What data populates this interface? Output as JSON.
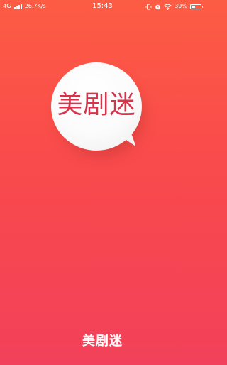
{
  "status_bar": {
    "network_type": "4G",
    "net_speed": "26.7K/s",
    "time": "15:43",
    "battery_percent": "39%",
    "battery_level": 0.39,
    "icons": [
      "signal-icon",
      "vibrate-icon",
      "alarm-icon",
      "wifi-icon",
      "battery-icon"
    ]
  },
  "splash": {
    "logo_text": "美剧迷",
    "app_name": "美剧迷"
  },
  "colors": {
    "background_top": "#fd5c44",
    "background_bottom": "#f2415a",
    "logo_text": "#d9334c",
    "bubble": "#ffffff"
  }
}
